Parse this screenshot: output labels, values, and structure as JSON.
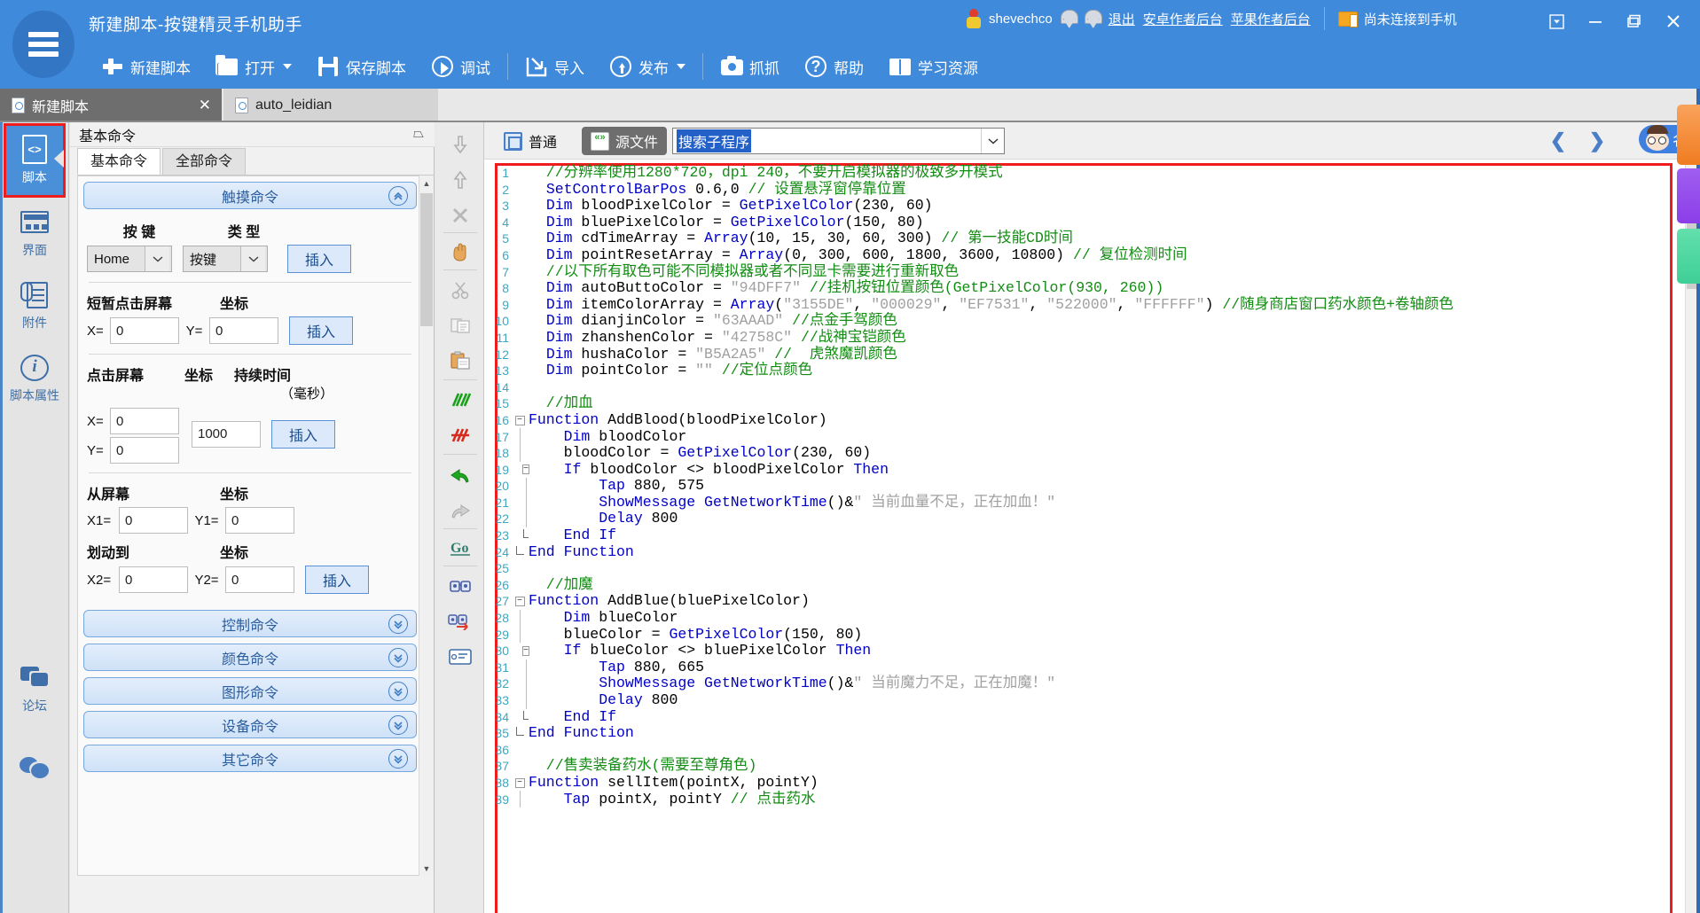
{
  "window": {
    "title": "新建脚本-按键精灵手机助手",
    "logo_icon": "list-logo-icon",
    "minimize": "−",
    "maximize": "❐",
    "close": "✕",
    "dropdown": "▾"
  },
  "account": {
    "avatar_icon": "user-avatar-icon",
    "name": "shevechco",
    "medal1_icon": "medal-icon",
    "medal2_icon": "medal-icon",
    "logout": "退出",
    "android_backend": "安卓作者后台",
    "ios_backend": "苹果作者后台",
    "phone_icon": "phone-device-icon",
    "phone_status": "尚未连接到手机"
  },
  "toolbar": {
    "items": [
      {
        "label": "新建脚本",
        "icon": "plus-icon",
        "caret": false
      },
      {
        "label": "打开",
        "icon": "folder-icon",
        "caret": true
      },
      {
        "label": "保存脚本",
        "icon": "floppy-save-icon",
        "caret": false
      },
      {
        "label": "调试",
        "icon": "play-circle-icon",
        "caret": false
      },
      {
        "label": "导入",
        "icon": "import-arrow-icon",
        "caret": false
      },
      {
        "label": "发布",
        "icon": "upload-circle-icon",
        "caret": true
      },
      {
        "label": "抓抓",
        "icon": "camera-icon",
        "caret": false
      },
      {
        "label": "帮助",
        "icon": "question-circle-icon",
        "caret": false
      },
      {
        "label": "学习资源",
        "icon": "book-icon",
        "caret": false
      }
    ]
  },
  "tabs": [
    {
      "label": "新建脚本",
      "active": true,
      "closable": true,
      "close_glyph": "✕",
      "icon": "document-icon"
    },
    {
      "label": "auto_leidian",
      "active": false,
      "closable": false,
      "icon": "document-icon"
    }
  ],
  "rail": {
    "items": [
      {
        "label": "脚本",
        "icon": "script-file-icon",
        "selected": true
      },
      {
        "label": "界面",
        "icon": "layout-ui-icon",
        "selected": false
      },
      {
        "label": "附件",
        "icon": "attachment-icon",
        "selected": false
      },
      {
        "label": "脚本属性",
        "icon": "info-circle-icon",
        "selected": false
      }
    ],
    "bottom_items": [
      {
        "label": "论坛",
        "icon": "forum-chat-icon"
      },
      {
        "label": "",
        "icon": "wechat-icon"
      }
    ]
  },
  "command_panel": {
    "header": "基本命令",
    "pin_icon": "pin-icon",
    "tabs": [
      {
        "label": "基本命令",
        "active": true
      },
      {
        "label": "全部命令",
        "active": false
      }
    ],
    "touch_section": {
      "title": "触摸命令",
      "collapse_icon": "chevron-up-circle-icon",
      "key_label": "按 键",
      "type_label": "类 型",
      "key_value": "Home",
      "type_value": "按键",
      "insert_label": "插入",
      "short_tap_label": "短暂点击屏幕",
      "coord_label": "坐标",
      "x_label": "X=",
      "y_label": "Y=",
      "x_value": "0",
      "y_value": "0",
      "tap_label": "点击屏幕",
      "coord_label2": "坐标",
      "duration_label": "持续时间",
      "duration_unit": "（毫秒）",
      "tap_x_value": "0",
      "tap_y_value": "0",
      "duration_value": "1000",
      "swipe_from_label": "从屏幕",
      "swipe_coord_label": "坐标",
      "x1_label": "X1=",
      "y1_label": "Y1=",
      "x1_value": "0",
      "y1_value": "0",
      "swipe_to_label": "划动到",
      "swipe_coord_label2": "坐标",
      "x2_label": "X2=",
      "y2_label": "Y2=",
      "x2_value": "0",
      "y2_value": "0"
    },
    "collapsed_sections": [
      {
        "label": "控制命令",
        "icon": "chevron-down-circle-icon"
      },
      {
        "label": "颜色命令",
        "icon": "chevron-down-circle-icon"
      },
      {
        "label": "图形命令",
        "icon": "chevron-down-circle-icon"
      },
      {
        "label": "设备命令",
        "icon": "chevron-down-circle-icon"
      },
      {
        "label": "其它命令",
        "icon": "chevron-down-circle-icon"
      }
    ]
  },
  "vertical_toolbar": {
    "items": [
      {
        "icon": "move-down-icon"
      },
      {
        "icon": "move-up-icon"
      },
      {
        "icon": "delete-x-icon"
      },
      {
        "icon": "hand-drag-icon"
      },
      {
        "icon": "cut-scissors-icon"
      },
      {
        "icon": "copy-icon"
      },
      {
        "icon": "paste-icon"
      },
      {
        "icon": "comment-add-icon"
      },
      {
        "icon": "comment-remove-icon"
      },
      {
        "icon": "undo-icon"
      },
      {
        "icon": "redo-icon"
      },
      {
        "icon": "goto-line-icon"
      },
      {
        "icon": "find-icon"
      },
      {
        "icon": "find-replace-icon"
      },
      {
        "icon": "properties-icon"
      }
    ]
  },
  "editor_toolbar": {
    "normal_view": "普通",
    "normal_icon": "normal-view-icon",
    "source_view": "源文件",
    "source_icon": "source-file-icon",
    "search_value": "搜索子程序",
    "combo_arrow_icon": "chevron-down-icon",
    "prev_icon": "chevron-left-icon",
    "prev_glyph": "❮",
    "next_icon": "chevron-right-icon",
    "next_glyph": "❯",
    "teacher_label": "名师答疑",
    "teacher_icon": "teacher-face-icon"
  },
  "code": {
    "lines": [
      {
        "n": 1,
        "fold": "",
        "tokens": [
          {
            "t": "c",
            "v": "  //分辨率使用1280*720，dpi 240，不要开启模拟器的极致多开模式"
          }
        ]
      },
      {
        "n": 2,
        "fold": "",
        "tokens": [
          {
            "t": "n",
            "v": "  "
          },
          {
            "t": "fn",
            "v": "SetControlBarPos"
          },
          {
            "t": "n",
            "v": " 0.6,0 "
          },
          {
            "t": "c",
            "v": "// 设置悬浮窗停靠位置"
          }
        ]
      },
      {
        "n": 3,
        "fold": "",
        "tokens": [
          {
            "t": "n",
            "v": "  "
          },
          {
            "t": "k",
            "v": "Dim"
          },
          {
            "t": "n",
            "v": " bloodPixelColor = "
          },
          {
            "t": "fn",
            "v": "GetPixelColor"
          },
          {
            "t": "n",
            "v": "(230, 60)"
          }
        ]
      },
      {
        "n": 4,
        "fold": "",
        "tokens": [
          {
            "t": "n",
            "v": "  "
          },
          {
            "t": "k",
            "v": "Dim"
          },
          {
            "t": "n",
            "v": " bluePixelColor = "
          },
          {
            "t": "fn",
            "v": "GetPixelColor"
          },
          {
            "t": "n",
            "v": "(150, 80)"
          }
        ]
      },
      {
        "n": 5,
        "fold": "",
        "tokens": [
          {
            "t": "n",
            "v": "  "
          },
          {
            "t": "k",
            "v": "Dim"
          },
          {
            "t": "n",
            "v": " cdTimeArray = "
          },
          {
            "t": "fn",
            "v": "Array"
          },
          {
            "t": "n",
            "v": "(10, 15, 30, 60, 300) "
          },
          {
            "t": "c",
            "v": "// 第一技能CD时间"
          }
        ]
      },
      {
        "n": 6,
        "fold": "",
        "tokens": [
          {
            "t": "n",
            "v": "  "
          },
          {
            "t": "k",
            "v": "Dim"
          },
          {
            "t": "n",
            "v": " pointResetArray = "
          },
          {
            "t": "fn",
            "v": "Array"
          },
          {
            "t": "n",
            "v": "(0, 300, 600, 1800, 3600, 10800) "
          },
          {
            "t": "c",
            "v": "// 复位检测时间"
          }
        ]
      },
      {
        "n": 7,
        "fold": "",
        "tokens": [
          {
            "t": "c",
            "v": "  //以下所有取色可能不同模拟器或者不同显卡需要进行重新取色"
          }
        ]
      },
      {
        "n": 8,
        "fold": "",
        "tokens": [
          {
            "t": "n",
            "v": "  "
          },
          {
            "t": "k",
            "v": "Dim"
          },
          {
            "t": "n",
            "v": " autoButtoColor = "
          },
          {
            "t": "s",
            "v": "\"94DFF7\""
          },
          {
            "t": "n",
            "v": " "
          },
          {
            "t": "c",
            "v": "//挂机按钮位置颜色(GetPixelColor(930, 260))"
          }
        ]
      },
      {
        "n": 9,
        "fold": "",
        "tokens": [
          {
            "t": "n",
            "v": "  "
          },
          {
            "t": "k",
            "v": "Dim"
          },
          {
            "t": "n",
            "v": " itemColorArray = "
          },
          {
            "t": "fn",
            "v": "Array"
          },
          {
            "t": "n",
            "v": "("
          },
          {
            "t": "s",
            "v": "\"3155DE\""
          },
          {
            "t": "n",
            "v": ", "
          },
          {
            "t": "s",
            "v": "\"000029\""
          },
          {
            "t": "n",
            "v": ", "
          },
          {
            "t": "s",
            "v": "\"EF7531\""
          },
          {
            "t": "n",
            "v": ", "
          },
          {
            "t": "s",
            "v": "\"522000\""
          },
          {
            "t": "n",
            "v": ", "
          },
          {
            "t": "s",
            "v": "\"FFFFFF\""
          },
          {
            "t": "n",
            "v": ") "
          },
          {
            "t": "c",
            "v": "//随身商店窗口药水颜色+卷轴颜色"
          }
        ]
      },
      {
        "n": 10,
        "fold": "",
        "tokens": [
          {
            "t": "n",
            "v": "  "
          },
          {
            "t": "k",
            "v": "Dim"
          },
          {
            "t": "n",
            "v": " dianjinColor = "
          },
          {
            "t": "s",
            "v": "\"63AAAD\""
          },
          {
            "t": "n",
            "v": " "
          },
          {
            "t": "c",
            "v": "//点金手驾颜色"
          }
        ]
      },
      {
        "n": 11,
        "fold": "",
        "tokens": [
          {
            "t": "n",
            "v": "  "
          },
          {
            "t": "k",
            "v": "Dim"
          },
          {
            "t": "n",
            "v": " zhanshenColor = "
          },
          {
            "t": "s",
            "v": "\"42758C\""
          },
          {
            "t": "n",
            "v": " "
          },
          {
            "t": "c",
            "v": "//战神宝铠颜色"
          }
        ]
      },
      {
        "n": 12,
        "fold": "",
        "tokens": [
          {
            "t": "n",
            "v": "  "
          },
          {
            "t": "k",
            "v": "Dim"
          },
          {
            "t": "n",
            "v": " hushaColor = "
          },
          {
            "t": "s",
            "v": "\"B5A2A5\""
          },
          {
            "t": "n",
            "v": " "
          },
          {
            "t": "c",
            "v": "//  虎煞魔凯颜色"
          }
        ]
      },
      {
        "n": 13,
        "fold": "",
        "tokens": [
          {
            "t": "n",
            "v": "  "
          },
          {
            "t": "k",
            "v": "Dim"
          },
          {
            "t": "n",
            "v": " pointColor = "
          },
          {
            "t": "s",
            "v": "\"\""
          },
          {
            "t": "n",
            "v": " "
          },
          {
            "t": "c",
            "v": "//定位点颜色"
          }
        ]
      },
      {
        "n": 14,
        "fold": "",
        "tokens": [
          {
            "t": "n",
            "v": ""
          }
        ]
      },
      {
        "n": 15,
        "fold": "",
        "tokens": [
          {
            "t": "c",
            "v": "  //加血"
          }
        ]
      },
      {
        "n": 16,
        "fold": "minus",
        "tokens": [
          {
            "t": "k",
            "v": "Function"
          },
          {
            "t": "n",
            "v": " AddBlood(bloodPixelColor)"
          }
        ]
      },
      {
        "n": 17,
        "fold": "bar",
        "tokens": [
          {
            "t": "n",
            "v": "    "
          },
          {
            "t": "k",
            "v": "Dim"
          },
          {
            "t": "n",
            "v": " bloodColor"
          }
        ]
      },
      {
        "n": 18,
        "fold": "bar",
        "tokens": [
          {
            "t": "n",
            "v": "    bloodColor = "
          },
          {
            "t": "fn",
            "v": "GetPixelColor"
          },
          {
            "t": "n",
            "v": "(230, 60)"
          }
        ]
      },
      {
        "n": 19,
        "fold": "minus2",
        "tokens": [
          {
            "t": "n",
            "v": "    "
          },
          {
            "t": "k",
            "v": "If"
          },
          {
            "t": "n",
            "v": " bloodColor <> bloodPixelColor "
          },
          {
            "t": "k",
            "v": "Then"
          }
        ]
      },
      {
        "n": 20,
        "fold": "bar2",
        "tokens": [
          {
            "t": "n",
            "v": "        "
          },
          {
            "t": "fn",
            "v": "Tap"
          },
          {
            "t": "n",
            "v": " 880, 575"
          }
        ]
      },
      {
        "n": 21,
        "fold": "bar2",
        "tokens": [
          {
            "t": "n",
            "v": "        "
          },
          {
            "t": "fn",
            "v": "ShowMessage GetNetworkTime"
          },
          {
            "t": "n",
            "v": "()&"
          },
          {
            "t": "s",
            "v": "\" 当前血量不足，正在加血！\""
          }
        ]
      },
      {
        "n": 22,
        "fold": "bar2",
        "tokens": [
          {
            "t": "n",
            "v": "        "
          },
          {
            "t": "fn",
            "v": "Delay"
          },
          {
            "t": "n",
            "v": " 800"
          }
        ]
      },
      {
        "n": 23,
        "fold": "end2",
        "tokens": [
          {
            "t": "n",
            "v": "    "
          },
          {
            "t": "k",
            "v": "End If"
          }
        ]
      },
      {
        "n": 24,
        "fold": "end",
        "tokens": [
          {
            "t": "k",
            "v": "End Function"
          }
        ]
      },
      {
        "n": 25,
        "fold": "",
        "tokens": [
          {
            "t": "n",
            "v": ""
          }
        ]
      },
      {
        "n": 26,
        "fold": "",
        "tokens": [
          {
            "t": "c",
            "v": "  //加魔"
          }
        ]
      },
      {
        "n": 27,
        "fold": "minus",
        "tokens": [
          {
            "t": "k",
            "v": "Function"
          },
          {
            "t": "n",
            "v": " AddBlue(bluePixelColor)"
          }
        ]
      },
      {
        "n": 28,
        "fold": "bar",
        "tokens": [
          {
            "t": "n",
            "v": "    "
          },
          {
            "t": "k",
            "v": "Dim"
          },
          {
            "t": "n",
            "v": " blueColor"
          }
        ]
      },
      {
        "n": 29,
        "fold": "bar",
        "tokens": [
          {
            "t": "n",
            "v": "    blueColor = "
          },
          {
            "t": "fn",
            "v": "GetPixelColor"
          },
          {
            "t": "n",
            "v": "(150, 80)"
          }
        ]
      },
      {
        "n": 30,
        "fold": "minus2",
        "tokens": [
          {
            "t": "n",
            "v": "    "
          },
          {
            "t": "k",
            "v": "If"
          },
          {
            "t": "n",
            "v": " blueColor <> bluePixelColor "
          },
          {
            "t": "k",
            "v": "Then"
          }
        ]
      },
      {
        "n": 31,
        "fold": "bar2",
        "tokens": [
          {
            "t": "n",
            "v": "        "
          },
          {
            "t": "fn",
            "v": "Tap"
          },
          {
            "t": "n",
            "v": " 880, 665"
          }
        ]
      },
      {
        "n": 32,
        "fold": "bar2",
        "tokens": [
          {
            "t": "n",
            "v": "        "
          },
          {
            "t": "fn",
            "v": "ShowMessage GetNetworkTime"
          },
          {
            "t": "n",
            "v": "()&"
          },
          {
            "t": "s",
            "v": "\" 当前魔力不足，正在加魔！\""
          }
        ]
      },
      {
        "n": 33,
        "fold": "bar2",
        "tokens": [
          {
            "t": "n",
            "v": "        "
          },
          {
            "t": "fn",
            "v": "Delay"
          },
          {
            "t": "n",
            "v": " 800"
          }
        ]
      },
      {
        "n": 34,
        "fold": "end2",
        "tokens": [
          {
            "t": "n",
            "v": "    "
          },
          {
            "t": "k",
            "v": "End If"
          }
        ]
      },
      {
        "n": 35,
        "fold": "end",
        "tokens": [
          {
            "t": "k",
            "v": "End Function"
          }
        ]
      },
      {
        "n": 36,
        "fold": "",
        "tokens": [
          {
            "t": "n",
            "v": ""
          }
        ]
      },
      {
        "n": 37,
        "fold": "",
        "tokens": [
          {
            "t": "c",
            "v": "  //售卖装备药水(需要至尊角色)"
          }
        ]
      },
      {
        "n": 38,
        "fold": "minus",
        "tokens": [
          {
            "t": "k",
            "v": "Function"
          },
          {
            "t": "n",
            "v": " sellItem(pointX, pointY)"
          }
        ]
      },
      {
        "n": 39,
        "fold": "bar",
        "tokens": [
          {
            "t": "n",
            "v": "    "
          },
          {
            "t": "fn",
            "v": "Tap"
          },
          {
            "t": "n",
            "v": " pointX, pointY "
          },
          {
            "t": "c",
            "v": "// 点击药水"
          }
        ]
      }
    ]
  },
  "colors": {
    "accent": "#3f8ada",
    "keyword": "#0000c8",
    "comment": "#128c12",
    "string": "#a0a0a0",
    "highlight_box": "#ee1c1c",
    "selection": "#2360c8"
  }
}
